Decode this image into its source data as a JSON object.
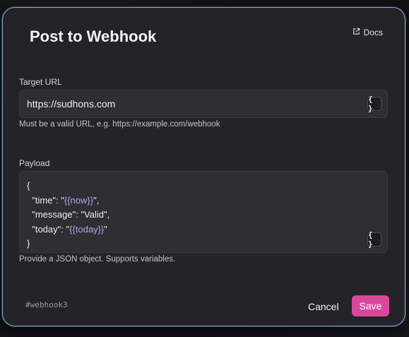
{
  "dialog": {
    "title": "Post to Webhook",
    "docs_label": "Docs"
  },
  "target_url": {
    "label": "Target URL",
    "value": "https://sudhons.com",
    "var_button": "{ }",
    "help": "Must be a valid URL, e.g. https://example.com/webhook"
  },
  "payload": {
    "label": "Payload",
    "lines": {
      "open": "{",
      "time_key": "  \"time\": \"",
      "time_var": "{{now}}",
      "time_end": "\",",
      "message": "  \"message\": \"Valid\",",
      "today_key": "  \"today\": \"",
      "today_var": "{{today}}",
      "today_end": "\"",
      "close": "}"
    },
    "var_button": "{ }",
    "help": "Provide a JSON object. Supports variables."
  },
  "footer": {
    "tag": "#webhook3",
    "cancel_label": "Cancel",
    "save_label": "Save"
  },
  "colors": {
    "accent": "#d9479d",
    "border_focus": "#7fa6e0",
    "variable": "#b5a4f0"
  }
}
